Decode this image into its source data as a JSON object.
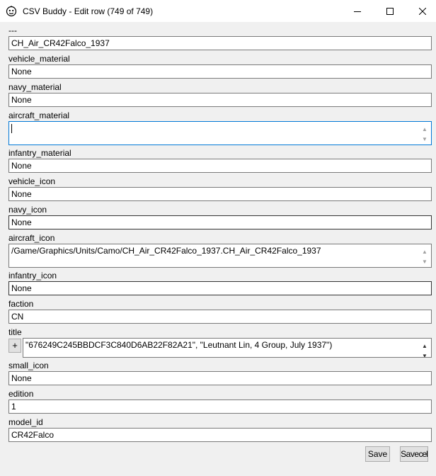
{
  "window": {
    "title": "CSV Buddy - Edit row (749 of 749)",
    "app_icon": "robot-face-icon"
  },
  "fields": [
    {
      "label": "---",
      "value": "CH_Air_CR42Falco_1937"
    },
    {
      "label": "vehicle_material",
      "value": "None"
    },
    {
      "label": "navy_material",
      "value": "None"
    },
    {
      "label": "aircraft_material",
      "value": ""
    },
    {
      "label": "infantry_material",
      "value": "None"
    },
    {
      "label": "vehicle_icon",
      "value": "None"
    },
    {
      "label": "navy_icon",
      "value": "None"
    },
    {
      "label": "aircraft_icon",
      "value": "/Game/Graphics/Units/Camo/CH_Air_CR42Falco_1937.CH_Air_CR42Falco_1937"
    },
    {
      "label": "infantry_icon",
      "value": "None"
    },
    {
      "label": "faction",
      "value": "CN"
    },
    {
      "label": "title",
      "value": "\"676249C245BBDCF3C840D6AB22F82A21\", \"Leutnant Lin, 4 Group, July 1937\")",
      "expand_label": "+"
    },
    {
      "label": "small_icon",
      "value": "None"
    },
    {
      "label": "edition",
      "value": "1"
    },
    {
      "label": "model_id",
      "value": "CR42Falco"
    }
  ],
  "buttons": {
    "save": "Save",
    "save_cancel": "Save",
    "save_cancel_tail": "cel"
  }
}
